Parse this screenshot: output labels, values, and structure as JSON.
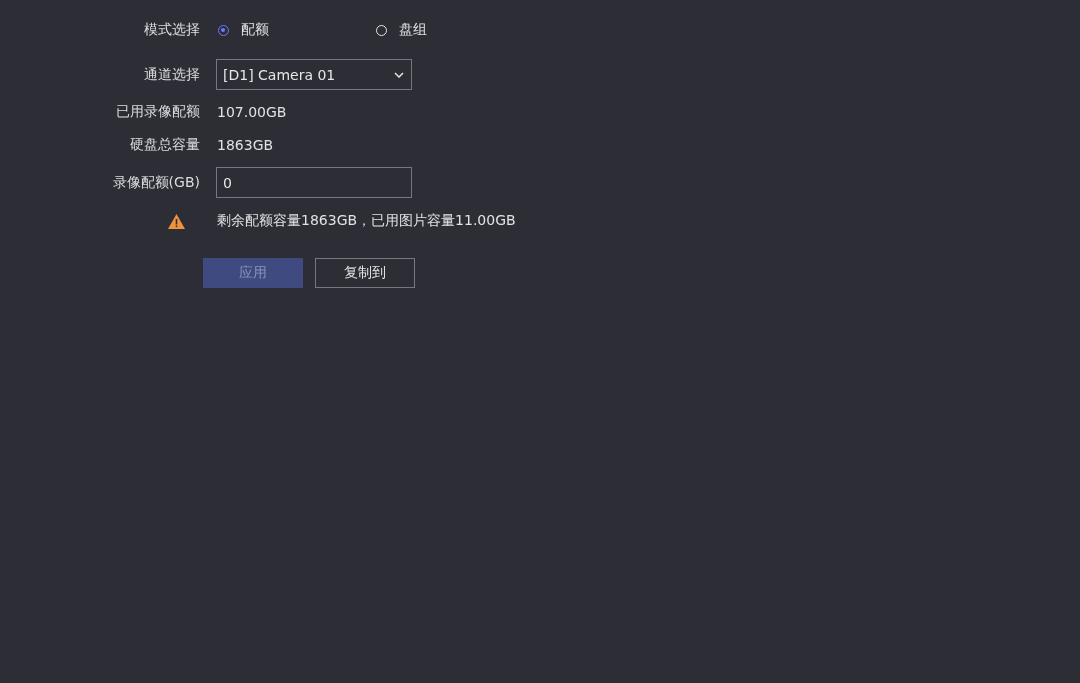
{
  "mode": {
    "label": "模式选择",
    "options": [
      {
        "label": "配额",
        "selected": true
      },
      {
        "label": "盘组",
        "selected": false
      }
    ]
  },
  "channel": {
    "label": "通道选择",
    "value": "[D1] Camera 01"
  },
  "used_quota": {
    "label": "已用录像配额",
    "value": "107.00GB"
  },
  "total_capacity": {
    "label": "硬盘总容量",
    "value": "1863GB"
  },
  "quota": {
    "label": "录像配额(GB)",
    "value": "0"
  },
  "warning": "剩余配额容量1863GB，已用图片容量11.00GB",
  "buttons": [
    {
      "label": "应用",
      "kind": "primary",
      "disabled": true
    },
    {
      "label": "复制到",
      "kind": "secondary",
      "disabled": false
    }
  ]
}
